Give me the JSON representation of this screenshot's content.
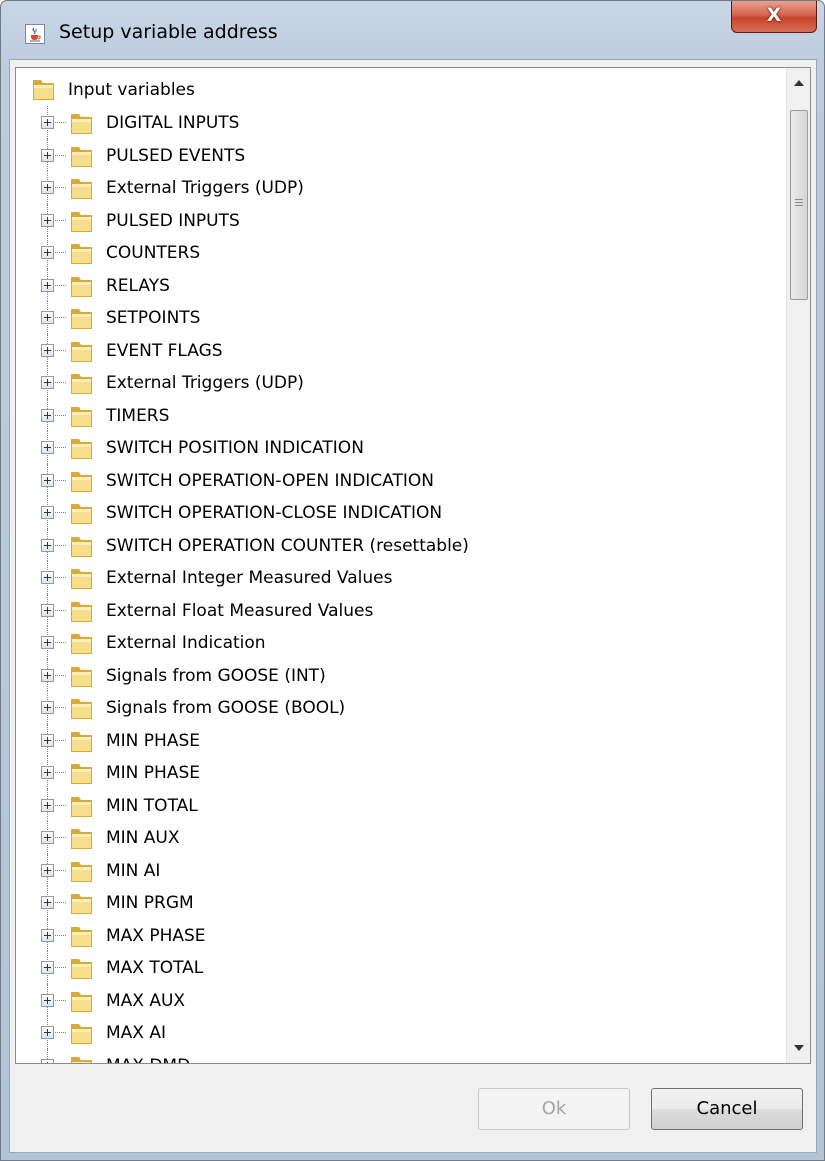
{
  "window": {
    "title": "Setup variable address",
    "close_label": "X"
  },
  "icons": {
    "app": "java-cup-icon",
    "folder": "folder-icon",
    "expand": "plus-expander-icon",
    "scroll_up": "arrow-up-icon",
    "scroll_down": "arrow-down-icon"
  },
  "colors": {
    "folder_light": "#f6de8a",
    "folder_dark": "#d9a93a",
    "close_red": "#c7432a"
  },
  "tree": {
    "root": {
      "label": "Input variables"
    },
    "items": [
      {
        "label": "DIGITAL INPUTS"
      },
      {
        "label": "PULSED EVENTS"
      },
      {
        "label": "External Triggers (UDP)"
      },
      {
        "label": "PULSED INPUTS"
      },
      {
        "label": "COUNTERS"
      },
      {
        "label": "RELAYS"
      },
      {
        "label": "SETPOINTS"
      },
      {
        "label": "EVENT FLAGS"
      },
      {
        "label": "External Triggers (UDP)"
      },
      {
        "label": "TIMERS"
      },
      {
        "label": "SWITCH POSITION INDICATION"
      },
      {
        "label": "SWITCH OPERATION-OPEN INDICATION"
      },
      {
        "label": "SWITCH OPERATION-CLOSE INDICATION"
      },
      {
        "label": "SWITCH OPERATION COUNTER (resettable)"
      },
      {
        "label": "External Integer Measured Values"
      },
      {
        "label": "External Float Measured Values"
      },
      {
        "label": "External Indication"
      },
      {
        "label": "Signals from GOOSE (INT)"
      },
      {
        "label": "Signals from GOOSE (BOOL)"
      },
      {
        "label": "MIN PHASE"
      },
      {
        "label": "MIN PHASE"
      },
      {
        "label": "MIN TOTAL"
      },
      {
        "label": "MIN AUX"
      },
      {
        "label": "MIN AI"
      },
      {
        "label": "MIN PRGM"
      },
      {
        "label": "MAX PHASE"
      },
      {
        "label": "MAX TOTAL"
      },
      {
        "label": "MAX AUX"
      },
      {
        "label": "MAX AI"
      },
      {
        "label": "MAX DMD"
      }
    ]
  },
  "buttons": {
    "ok_label": "Ok",
    "cancel_label": "Cancel"
  }
}
